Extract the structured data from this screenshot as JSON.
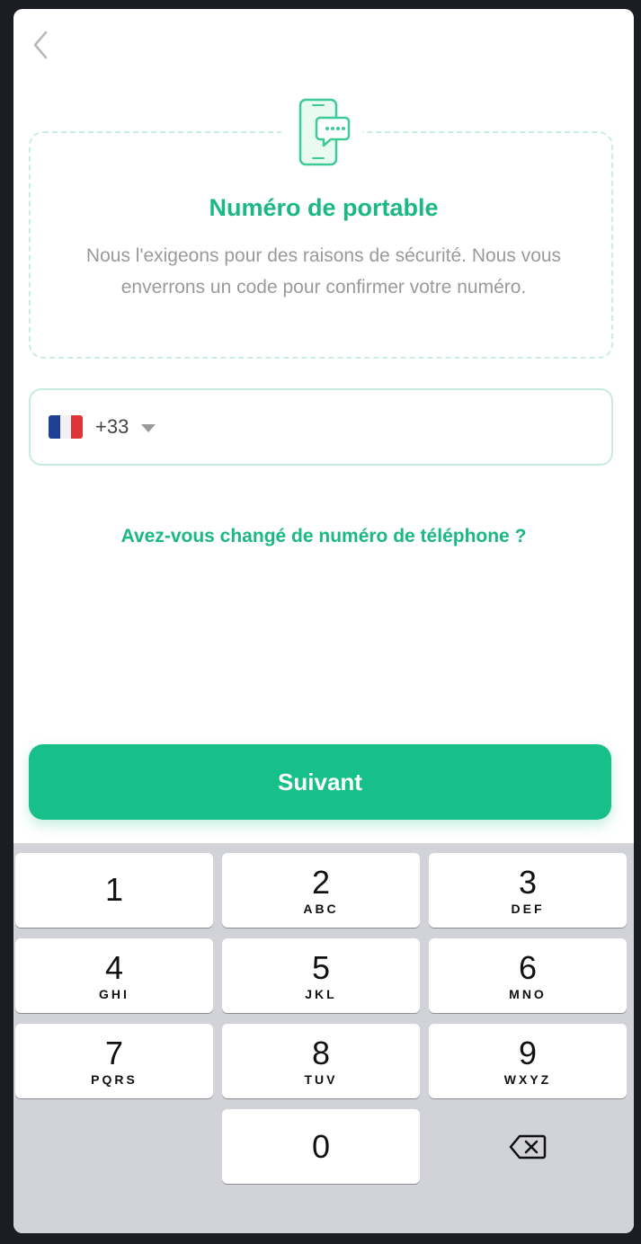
{
  "header": {
    "back_icon": "chevron-left-icon"
  },
  "info_card": {
    "icon": "phone-message-icon",
    "title": "Numéro de portable",
    "description": "Nous l'exigeons pour des raisons de sécurité. Nous vous enverrons un code pour confirmer votre numéro."
  },
  "phone_input": {
    "country_flag": "flag-france-icon",
    "dial_code": "+33",
    "value": ""
  },
  "change_link": "Avez-vous changé de numéro de téléphone ?",
  "next_button": "Suivant",
  "keypad": {
    "keys": [
      {
        "digit": "1",
        "letters": ""
      },
      {
        "digit": "2",
        "letters": "ABC"
      },
      {
        "digit": "3",
        "letters": "DEF"
      },
      {
        "digit": "4",
        "letters": "GHI"
      },
      {
        "digit": "5",
        "letters": "JKL"
      },
      {
        "digit": "6",
        "letters": "MNO"
      },
      {
        "digit": "7",
        "letters": "PQRS"
      },
      {
        "digit": "8",
        "letters": "TUV"
      },
      {
        "digit": "9",
        "letters": "WXYZ"
      },
      {
        "digit": "0",
        "letters": ""
      }
    ],
    "delete_icon": "backspace-icon"
  },
  "colors": {
    "accent": "#17c089",
    "accent_text": "#1bb886",
    "keypad_bg": "#d1d3d9"
  }
}
